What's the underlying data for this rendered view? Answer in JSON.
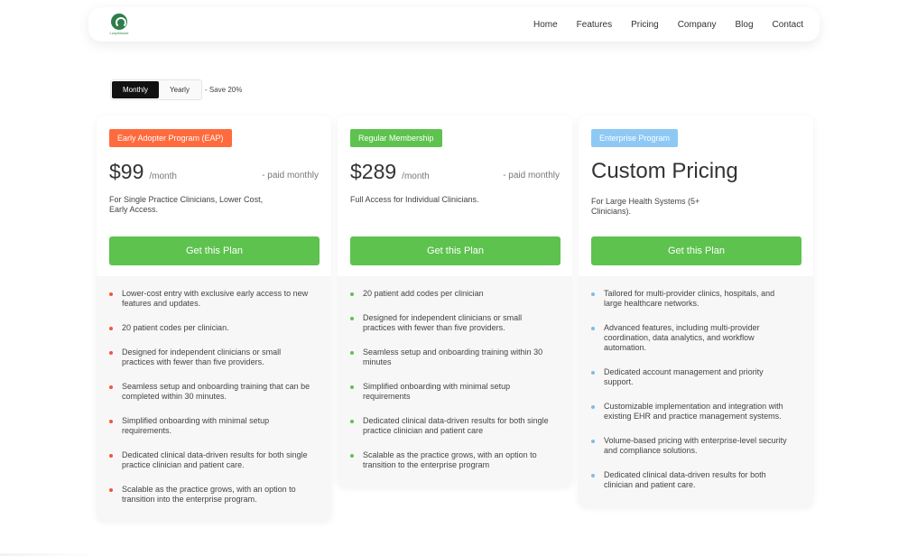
{
  "brand": {
    "logo_text": "LoopMouse",
    "color": "#2f7d4a"
  },
  "nav": {
    "items": [
      "Home",
      "Features",
      "Pricing",
      "Company",
      "Blog",
      "Contact"
    ]
  },
  "billing": {
    "monthly": "Monthly",
    "yearly": "Yearly",
    "save_note": "- Save 20%",
    "selected": "Monthly"
  },
  "plans": [
    {
      "badge": "Early Adopter Program (EAP)",
      "badge_color": "#ff6b3d",
      "dot_color": "#f0573a",
      "price": "$99",
      "per": "/month",
      "paid": "- paid monthly",
      "description": "For Single Practice Clinicians, Lower Cost, Early Access.",
      "cta": "Get this Plan",
      "features": [
        "Lower-cost entry with exclusive early access to new features and updates.",
        "20 patient codes per clinician.",
        "Designed for independent clinicians or small practices with fewer than five providers.",
        "Seamless setup and onboarding training that can be completed within 30 minutes.",
        "Simplified onboarding with minimal setup requirements.",
        "Dedicated clinical data-driven results for both single practice clinician and patient care.",
        "Scalable as the practice grows, with an option to transition into the enterprise program."
      ]
    },
    {
      "badge": "Regular Membership",
      "badge_color": "#5dc24e",
      "dot_color": "#5dc24e",
      "price": "$289",
      "per": "/month",
      "paid": "- paid monthly",
      "description": "Full Access for Individual Clinicians.",
      "cta": "Get this Plan",
      "features": [
        "20 patient add codes per clinician",
        "Designed for independent clinicians or small practices with fewer than five providers.",
        "Seamless setup and onboarding training within 30 minutes",
        "Simplified onboarding with minimal setup requirements",
        "Dedicated clinical data-driven results for both single practice clinician and patient care",
        "Scalable as the practice grows, with an option to transition to the enterprise program"
      ]
    },
    {
      "badge": "Enterprise Program",
      "badge_color": "#8ec9f5",
      "dot_color": "#7bbcec",
      "price": "Custom Pricing",
      "description": "For Large Health Systems (5+ Clinicians).",
      "cta": "Get this Plan",
      "features": [
        "Tailored for multi-provider clinics, hospitals, and large healthcare networks.",
        "Advanced features, including multi-provider coordination, data analytics, and workflow automation.",
        "Dedicated account management and priority support.",
        "Customizable implementation and integration with existing EHR and practice management systems.",
        "Volume-based pricing with enterprise-level security and compliance solutions.",
        "Dedicated clinical data-driven results for both clinician and patient care."
      ]
    }
  ]
}
